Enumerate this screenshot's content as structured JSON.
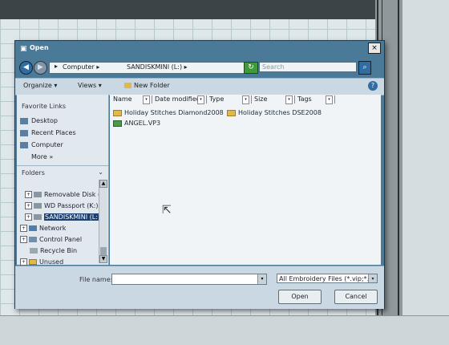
{
  "dialog": {
    "title": "Open",
    "close_glyph": "×",
    "address": {
      "back_glyph": "◀",
      "forward_glyph": "▶",
      "chevron": "▸",
      "segment1": "Computer ▸",
      "segment2": "SANDISKMINI (L:) ▸",
      "dropdown": "▾",
      "refresh_glyph": "↻",
      "search_placeholder": "Search",
      "search_glyph": "⌕"
    },
    "toolbar": {
      "organize": "Organize ▾",
      "views": "Views ▾",
      "new_folder": "New Folder",
      "help_glyph": "?"
    },
    "nav": {
      "favorite_links_heading": "Favorite Links",
      "favorite_links": [
        {
          "label": "Desktop",
          "icon": "desktop-icon"
        },
        {
          "label": "Recent Places",
          "icon": "recent-places-icon"
        },
        {
          "label": "Computer",
          "icon": "computer-icon"
        },
        {
          "label": "More »",
          "icon": ""
        }
      ],
      "folders_label": "Folders",
      "folders_chevron": "⌄",
      "tree": [
        {
          "label": "Removable Disk (J",
          "expander": "+"
        },
        {
          "label": "WD Passport (K:)",
          "expander": "+"
        },
        {
          "label": "SANDISKMINI (L:)",
          "expander": "+"
        },
        {
          "label": "Network",
          "expander": "+"
        },
        {
          "label": "Control Panel",
          "expander": "+"
        },
        {
          "label": "Recycle Bin",
          "expander": ""
        },
        {
          "label": "Unused",
          "expander": "+"
        }
      ]
    },
    "columns": [
      "Name",
      "Date modified",
      "Type",
      "Size",
      "Tags"
    ],
    "files": [
      {
        "name": "Holiday Stitches Diamond2008",
        "kind": "folder"
      },
      {
        "name": "Holiday Stitches DSE2008",
        "kind": "folder"
      },
      {
        "name": "ANGEL.VP3",
        "kind": "file"
      }
    ],
    "bottom": {
      "file_name_label": "File name:",
      "file_name_value": "",
      "filter": "All Embroidery Files (*.vip;*.vp",
      "open_button": "Open",
      "cancel_button": "Cancel",
      "dropdown_glyph": "▾"
    }
  }
}
